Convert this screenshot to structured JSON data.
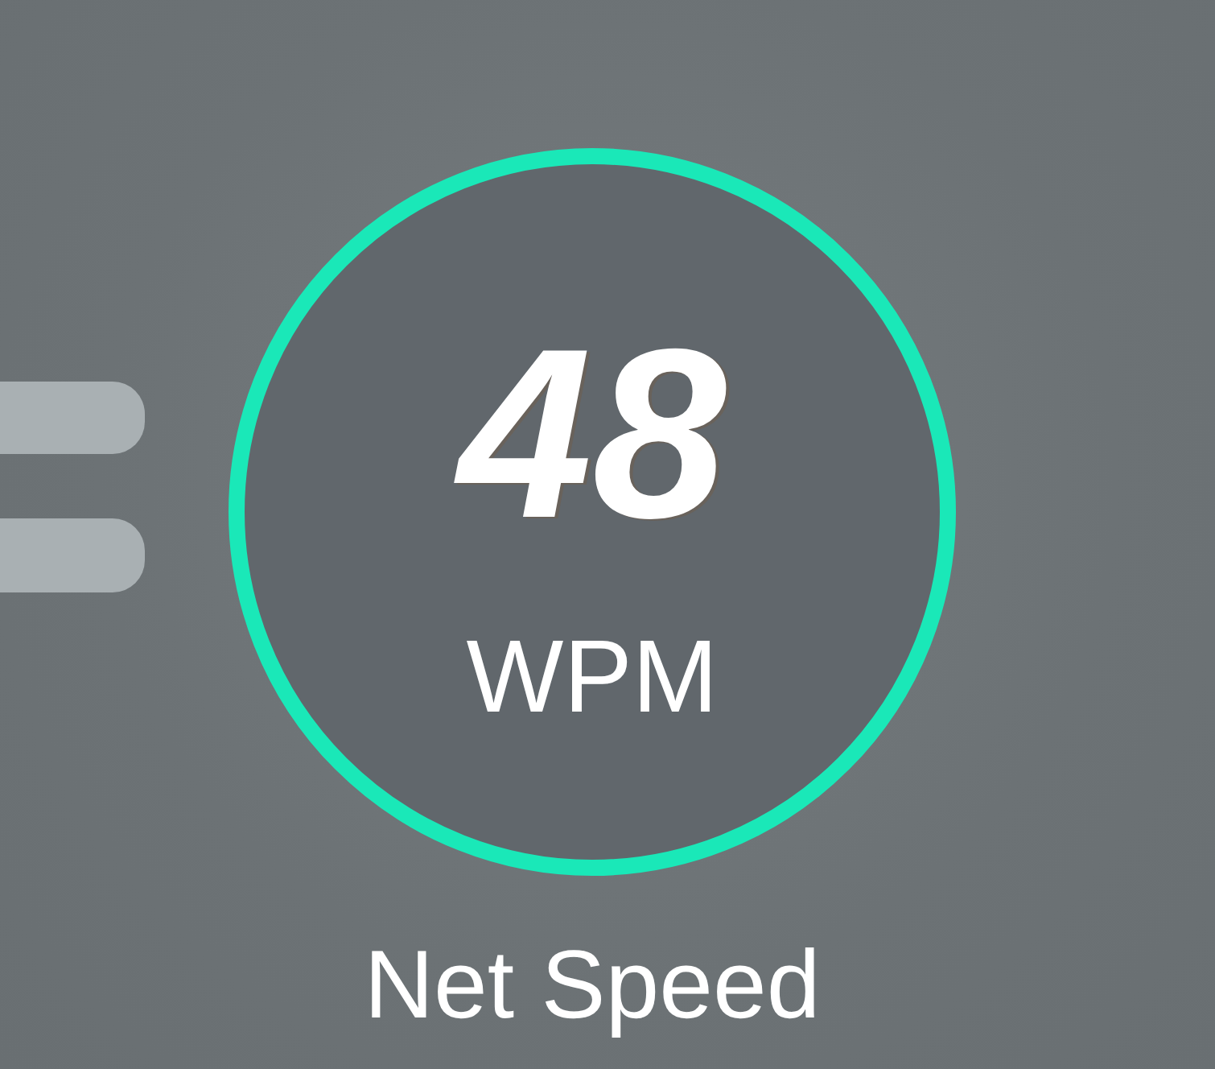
{
  "speed": {
    "value": "48",
    "unit": "WPM",
    "label": "Net Speed"
  }
}
